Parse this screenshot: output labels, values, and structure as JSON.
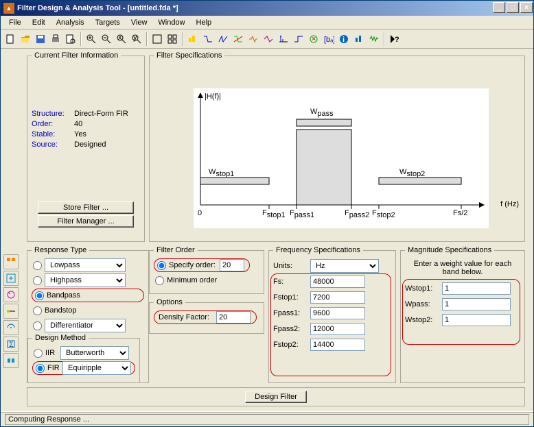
{
  "window": {
    "title": "Filter Design & Analysis Tool  -  [untitled.fda *]"
  },
  "menus": [
    "File",
    "Edit",
    "Analysis",
    "Targets",
    "View",
    "Window",
    "Help"
  ],
  "filter_info": {
    "legend": "Current Filter Information",
    "structure_label": "Structure:",
    "structure": "Direct-Form FIR",
    "order_label": "Order:",
    "order": "40",
    "stable_label": "Stable:",
    "stable": "Yes",
    "source_label": "Source:",
    "source": "Designed",
    "store_btn": "Store Filter ...",
    "manager_btn": "Filter Manager ..."
  },
  "specs": {
    "legend": "Filter Specifications",
    "hf": "|H(f)|",
    "wstop1": "W",
    "wstop1_sub": "stop1",
    "wpass": "W",
    "wpass_sub": "pass",
    "wstop2": "W",
    "wstop2_sub": "stop2",
    "zero": "0",
    "fstop1": "F",
    "fstop1_sub": "stop1",
    "fpass1": "F",
    "fpass1_sub": "pass1",
    "fpass2": "F",
    "fpass2_sub": "pass2",
    "fstop2": "F",
    "fstop2_sub": "stop2",
    "fs2": "Fs/2",
    "fhz": "f (Hz)"
  },
  "response_type": {
    "legend": "Response Type",
    "lowpass": "Lowpass",
    "highpass": "Highpass",
    "bandpass": "Bandpass",
    "bandstop": "Bandstop",
    "differentiator": "Differentiator"
  },
  "design_method": {
    "legend": "Design Method",
    "iir": "IIR",
    "iir_val": "Butterworth",
    "fir": "FIR",
    "fir_val": "Equiripple"
  },
  "filter_order": {
    "legend": "Filter Order",
    "specify": "Specify order:",
    "value": "20",
    "minimum": "Minimum order"
  },
  "options": {
    "legend": "Options",
    "density_label": "Density Factor:",
    "density": "20"
  },
  "freq": {
    "legend": "Frequency Specifications",
    "units_label": "Units:",
    "units": "Hz",
    "fs_label": "Fs:",
    "fs": "48000",
    "fstop1_label": "Fstop1:",
    "fstop1": "7200",
    "fpass1_label": "Fpass1:",
    "fpass1": "9600",
    "fpass2_label": "Fpass2:",
    "fpass2": "12000",
    "fstop2_label": "Fstop2:",
    "fstop2": "14400"
  },
  "mag": {
    "legend": "Magnitude Specifications",
    "hint": "Enter a weight value for each band below.",
    "wstop1_label": "Wstop1:",
    "wstop1": "1",
    "wpass_label": "Wpass:",
    "wpass": "1",
    "wstop2_label": "Wstop2:",
    "wstop2": "1"
  },
  "design_btn": "Design Filter",
  "status": "Computing Response ..."
}
